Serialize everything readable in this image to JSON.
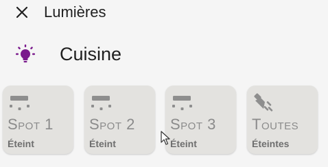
{
  "header": {
    "title": "Lumières",
    "close_icon": "close-icon"
  },
  "room": {
    "name": "Cuisine",
    "icon": "lightbulb-icon",
    "icon_color": "#7a1a8c"
  },
  "tiles": [
    {
      "name": "Spot 1",
      "state": "Éteint",
      "icon": "ceiling-spot-icon"
    },
    {
      "name": "Spot 2",
      "state": "Éteint",
      "icon": "ceiling-spot-icon"
    },
    {
      "name": "Spot 3",
      "state": "Éteint",
      "icon": "ceiling-spot-icon"
    },
    {
      "name": "Toutes",
      "state": "Éteintes",
      "icon": "spotlight-icon"
    }
  ],
  "colors": {
    "tile_bg": "#e3e2df",
    "tile_text": "#8b8b8b",
    "icon_gray": "#8e8e8e"
  }
}
